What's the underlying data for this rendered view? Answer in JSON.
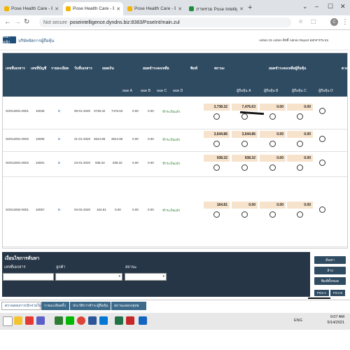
{
  "browser": {
    "tabs": [
      {
        "label": "Pose Health Care - ERP",
        "active": false
      },
      {
        "label": "Pose Health Care - ERP",
        "active": true
      },
      {
        "label": "Pose Health Care - ERP",
        "active": false
      },
      {
        "label": "ภาพรวม Pose Intelligence - Goo",
        "active": false
      }
    ],
    "new_tab": "+",
    "address": {
      "security": "Not secure",
      "url": "poseintelligence.dyndns.biz:8383/PoseInt/main.zul"
    }
  },
  "app": {
    "menu_label": "หน้าหลัก",
    "subtitle": "บริษัทจัดการผู้ถือหุ้น",
    "user_info": "Admin 01 Admin  สิทธิ์ Admin  Report  ออกจากระบบ"
  },
  "table": {
    "headers": {
      "doc_no": "เลขที่เอกสาร",
      "account_no": "เลขที่บัญชี",
      "detail": "รายละเอียด",
      "doc_date": "วันที่เอกสาร",
      "amount": "ยอดเงิน",
      "balance": "ยอดคงเหลือ",
      "print": "พิมพ์",
      "status": "สถานะ",
      "group_main": "ยอดชำระคงเหลือ",
      "group_paid": "ยอดชำระคงเหลือผู้ถือหุ้น",
      "more": "ดวง",
      "sub_a": "ยอด A",
      "sub_b": "ยอด B",
      "sub_c": "ยอด C",
      "sub_d": "ยอด D",
      "pay_a": "ผู้ถือหุ้น A",
      "pay_b": "ผู้ถือหุ้น B",
      "pay_c": "ผู้ถือหุ้น C",
      "pay_d": "ผู้ถือหุ้น D"
    },
    "rows": [
      {
        "doc_no": "SO012001-0001",
        "account_no": "10028",
        "detail": "D",
        "doc_date": "09-01-2020",
        "amount": "3738.32",
        "balance": "7476.63",
        "bal_c": "0.00",
        "bal_d": "0.00",
        "status": "ชำระเงินแล้ว",
        "due": "3,738.32",
        "pay_a": "7,476.63",
        "pay_b": "0.00",
        "pay_c": "0.00"
      },
      {
        "doc_no": "SO012001-0002",
        "account_no": "10006",
        "detail": "D",
        "doc_date": "21-01-2020",
        "amount": "3644.86",
        "balance": "3644.86",
        "bal_c": "0.00",
        "bal_d": "0.00",
        "status": "ชำระเงินแล้ว",
        "due": "3,644.86",
        "pay_a": "3,644.86",
        "pay_b": "0.00",
        "pay_c": "0.00"
      },
      {
        "doc_no": "SO012001-0003",
        "account_no": "10001",
        "detail": "D",
        "doc_date": "23-01-2020",
        "amount": "938.32",
        "balance": "938.32",
        "bal_c": "0.00",
        "bal_d": "0.00",
        "status": "ชำระเงินแล้ว",
        "due": "938.32",
        "pay_a": "938.32",
        "pay_b": "0.00",
        "pay_c": "0.00"
      },
      {
        "doc_no": "SO012002-0001",
        "account_no": "10057",
        "detail": "D",
        "doc_date": "03-02-2020",
        "amount": "164.81",
        "balance": "0.00",
        "bal_c": "0.00",
        "bal_d": "0.00",
        "status": "ชำระเงินแล้ว",
        "due": "164.81",
        "pay_a": "0.00",
        "pay_b": "0.00",
        "pay_c": "0.00"
      }
    ]
  },
  "search": {
    "title": "เงื่อนไขการค้นหา",
    "label_doc": "เลขที่เอกสาร",
    "label_customer": "ลูกค้า",
    "label_status": "สถานะ",
    "search_btn": "ค้นหา",
    "clear_btn": "ล้าง",
    "print_all_btn": "พิมพ์ทั้งหมด",
    "print_a": "Print A",
    "print_b": "Print B",
    "print_c": "Print C",
    "print_d": "Print D"
  },
  "bottom_tabs": [
    "ตรวจสอบการเบิกจ่ายใบสำคัญ",
    "รายละเอียดทั้ง",
    "ประวัติการชำระผู้ถือหุ้น",
    "สถานะผลกงยุทธ"
  ],
  "taskbar": {
    "time": "9:07 AM",
    "date": "5/14/2021",
    "language": "ENG"
  },
  "colors": {
    "header": "#2f4b62",
    "panel": "#263646",
    "amount_fill": "#f7e3cc",
    "status_green": "#2e7d32"
  }
}
